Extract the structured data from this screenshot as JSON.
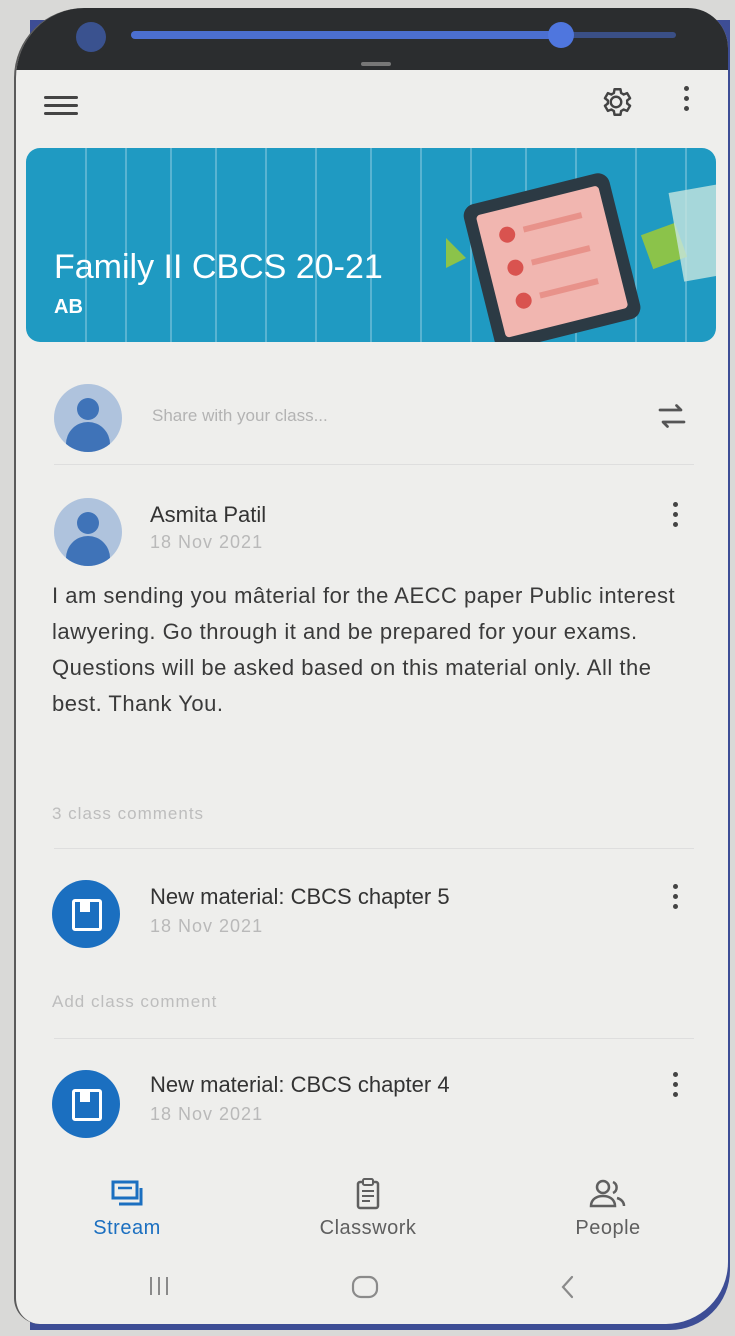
{
  "class": {
    "title": "Family II CBCS 20-21",
    "section": "AB",
    "banner_color": "#1f9ac2"
  },
  "share": {
    "placeholder": "Share with your class..."
  },
  "post": {
    "author": "Asmita Patil",
    "date": "18 Nov 2021",
    "text": "I am sending you mâterial for the AECC paper Public interest lawyering. Go through it and be prepared for your exams. Questions will be asked based on this material only. All the best. Thank You.",
    "comments": "3 class comments"
  },
  "materials": [
    {
      "title": "New material: CBCS chapter  5",
      "date": "18 Nov 2021",
      "comment_link": "Add class comment"
    },
    {
      "title": "New material: CBCS chapter  4",
      "date": "18 Nov 2021"
    }
  ],
  "nav": {
    "items": [
      {
        "label": "Stream",
        "icon": "stream-icon",
        "active": true
      },
      {
        "label": "Classwork",
        "icon": "classwork-icon",
        "active": false
      },
      {
        "label": "People",
        "icon": "people-icon",
        "active": false
      }
    ],
    "active_color": "#1b6fc0",
    "inactive_color": "#5f5f5f"
  },
  "system": {
    "recent": "recent-apps-icon",
    "home": "home-icon",
    "back": "back-icon"
  }
}
